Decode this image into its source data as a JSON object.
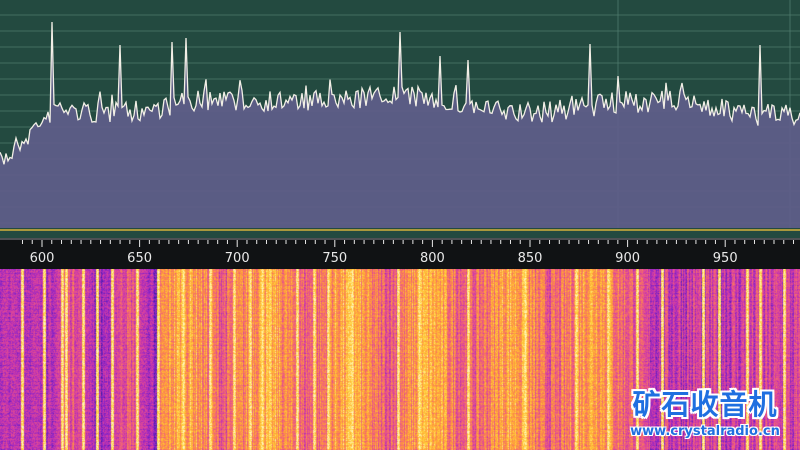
{
  "spectrum": {
    "background_color": "#234a40",
    "fill_color": "#5f5d8a",
    "trace_color": "#f2efe6",
    "grid_color": "#4f7a6c",
    "baseline_color": "#d6b23a"
  },
  "frequency_axis": {
    "ticks": [
      "600",
      "650",
      "700",
      "750",
      "800",
      "850",
      "900",
      "950"
    ],
    "tick_color": "#e9e9e9"
  },
  "waterfall": {
    "palette": [
      "#3a1aa6",
      "#8a24c8",
      "#d03aa8",
      "#f0607a",
      "#ff9a3a",
      "#ffd23a",
      "#fff7c8"
    ]
  },
  "watermark": {
    "title": "矿石收音机",
    "url": "www.crystalradio.cn"
  }
}
